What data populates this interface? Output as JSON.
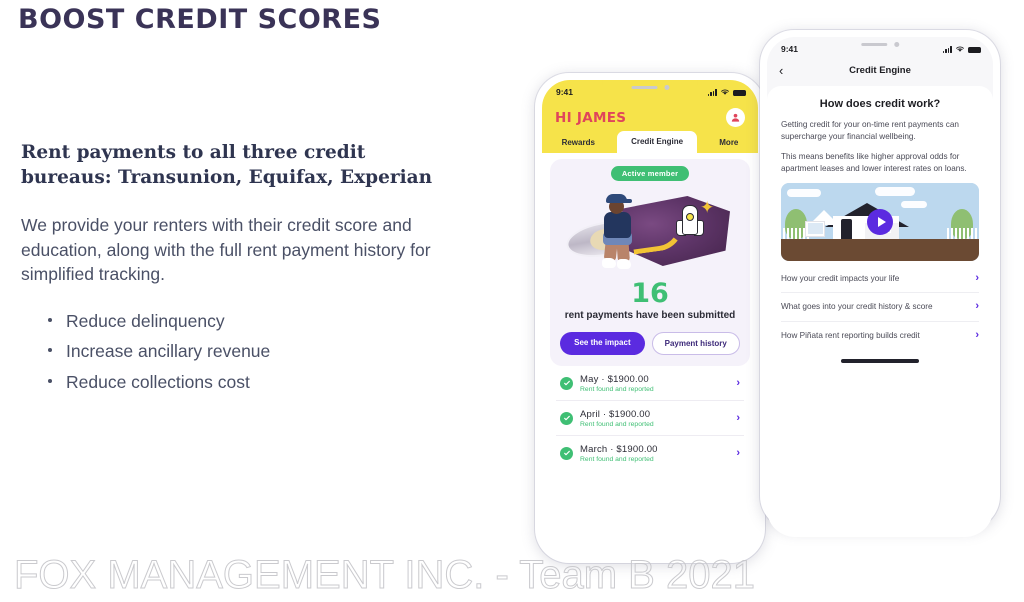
{
  "slide": {
    "title": "BOOST CREDIT SCORES",
    "lead": "Rent payments to all three credit bureaus: Transunion, Equifax, Experian",
    "paragraph": "We provide your renters with their credit score and education, along with the full rent payment history for simplified tracking.",
    "bullets": [
      "Reduce delinquency",
      "Increase ancillary revenue",
      "Reduce collections cost"
    ],
    "watermark": "FOX MANAGEMENT INC. - Team B 2021",
    "colors": {
      "heading": "#3a3357",
      "body_text": "#4a5066",
      "brand_yellow": "#F6E34A",
      "brand_purple": "#5B2BE0",
      "brand_green": "#3FBF74",
      "brand_red": "#E0455B"
    }
  },
  "phone_left": {
    "status": {
      "time": "9:41"
    },
    "greeting": "HI JAMES",
    "tabs": [
      {
        "label": "Rewards",
        "active": false
      },
      {
        "label": "Credit Engine",
        "active": true
      },
      {
        "label": "More",
        "active": false
      }
    ],
    "hero": {
      "badge": "Active member",
      "count": "16",
      "count_caption": "rent payments have been submitted",
      "primary_button": "See the impact",
      "secondary_button": "Payment history"
    },
    "payments": [
      {
        "title": "May  ·  $1900.00",
        "status": "Rent found and reported"
      },
      {
        "title": "April  ·  $1900.00",
        "status": "Rent found and reported"
      },
      {
        "title": "March  ·  $1900.00",
        "status": "Rent found and reported"
      }
    ]
  },
  "phone_right": {
    "status": {
      "time": "9:41"
    },
    "nav_title": "Credit Engine",
    "heading": "How does credit work?",
    "paragraphs": [
      "Getting credit for your on-time rent payments can supercharge your financial wellbeing.",
      "This means benefits like higher approval odds for apartment leases and lower interest rates on loans."
    ],
    "list": [
      "How your credit impacts your life",
      "What goes into your credit history & score",
      "How Piñata rent reporting builds credit"
    ]
  }
}
